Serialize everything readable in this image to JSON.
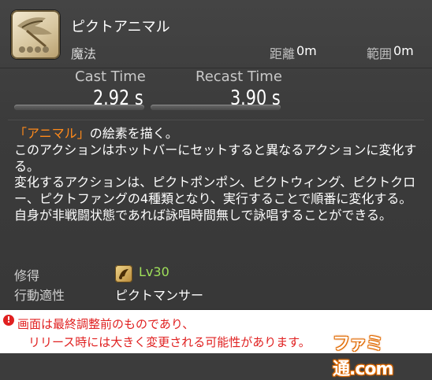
{
  "action": {
    "name": "ピクトアニマル",
    "category": "魔法",
    "range_label": "距離",
    "range_value": "0m",
    "radius_label": "範囲",
    "radius_value": "0m",
    "icon": "pict-animal-icon"
  },
  "timing": {
    "cast_label": "Cast Time",
    "cast_value": "2.92 s",
    "recast_label": "Recast Time",
    "recast_value": "3.90 s"
  },
  "description": {
    "line1_highlight": "「アニマル」",
    "line1_rest": "の絵素を描く。",
    "line2": "このアクションはホットバーにセットすると異なるアクションに変化する。",
    "line3": "変化するアクションは、ピクトポンポン、ピクトウィング、ピクトクロー、ピクトファングの4種類となり、実行することで順番に変化する。",
    "line4": "自身が非戦闘状態であれば詠唱時間無しで詠唱することができる。"
  },
  "meta": {
    "acquired_label": "修得",
    "acquired_value": "Lv30",
    "job_icon": "pictomancer-job-icon",
    "class_label": "行動適性",
    "class_value": "ピクトマンサー"
  },
  "notice": {
    "line1": "画面は最終調整前のものであり、",
    "line2": "リリース時には大きく変更される可能性があります。",
    "watermark": "ファミ通.com"
  },
  "colors": {
    "highlight": "#ff8a1a",
    "level": "#9fe05a",
    "notice": "#e02020"
  }
}
